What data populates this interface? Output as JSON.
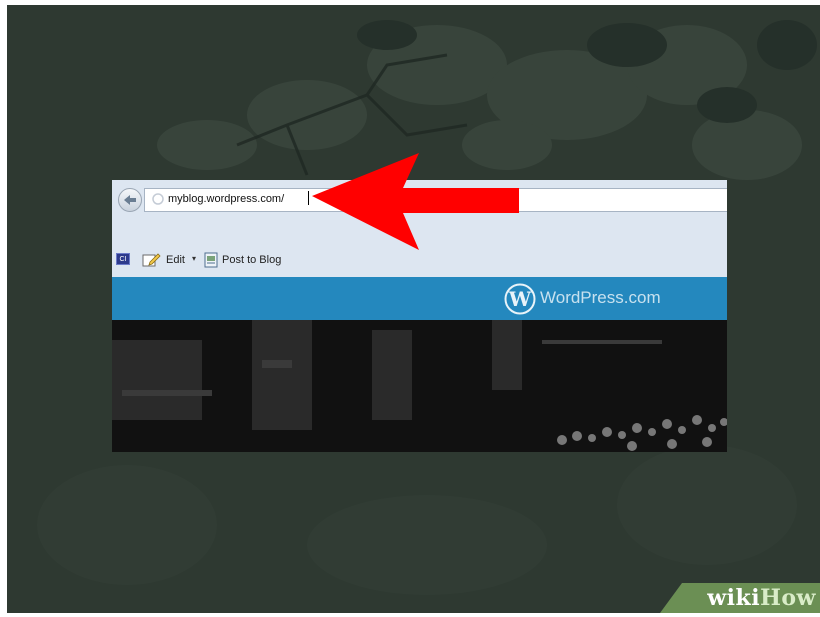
{
  "browser": {
    "address_url": "myblog.wordpress.com/",
    "toolbar": {
      "ci_badge": "CI",
      "edit_label": "Edit",
      "edit_dropdown": "▾",
      "post_label": "Post to Blog"
    }
  },
  "wordpress_banner": {
    "logo_letter": "W",
    "name": "WordPress.com",
    "color": "#2488be"
  },
  "annotation": {
    "arrow_color": "#ff0000"
  },
  "watermark": {
    "part1": "wiki",
    "part2": "How"
  }
}
